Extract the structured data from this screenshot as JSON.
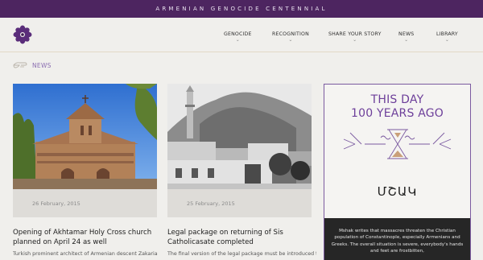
{
  "topbar": {
    "title": "ARMENIAN GENOCIDE CENTENNIAL"
  },
  "nav": {
    "items": [
      {
        "label": "GENOCIDE"
      },
      {
        "label": "RECOGNITION"
      },
      {
        "label": "SHARE YOUR STORY"
      },
      {
        "label": "NEWS"
      },
      {
        "label": "LIBRARY"
      }
    ]
  },
  "section": {
    "label": "NEWS"
  },
  "cards": [
    {
      "date": "26 February, 2015",
      "title": "Opening of Akhtamar Holy Cross church planned on April 24 as well",
      "excerpt": "Turkish prominent architect of Armenian descent Zakaria"
    },
    {
      "date": "25 February, 2015",
      "title": "Legal package on returning of Sis Catholicasate completed",
      "excerpt": "The final version of the legal package must be introduced to"
    }
  ],
  "sidebar": {
    "heading_line1": "THIS DAY",
    "heading_line2": "100 YEARS AGO",
    "newspaper": "ՄՇԱԿ",
    "text": "Mshak writes that massacres threaten the Christian population of Constantinople, especially Armenians and Greeks. The overall situation is severe, everybody's hands and feet are frostbitten,"
  },
  "colors": {
    "brand_purple": "#4d2560",
    "accent_purple": "#8a6db0",
    "heading_purple": "#6d3f9a"
  }
}
